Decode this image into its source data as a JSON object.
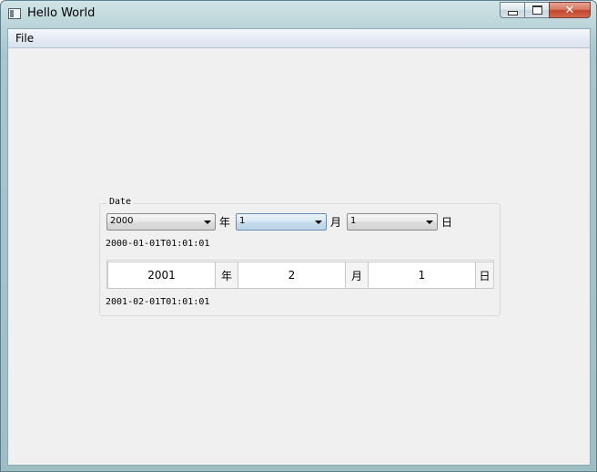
{
  "window": {
    "title": "Hello World",
    "close_glyph": "✕"
  },
  "menu": {
    "items": [
      "File"
    ]
  },
  "group": {
    "title": "Date",
    "combos": {
      "year": "2000",
      "month": "1",
      "day": "1"
    },
    "units": {
      "year": "年",
      "month": "月",
      "day": "日"
    },
    "datetime_1": "2000-01-01T01:01:01",
    "cells": {
      "year": "2001",
      "month": "2",
      "day": "1"
    },
    "datetime_2": "2001-02-01T01:01:01"
  },
  "icons": {
    "app": "window-app-icon",
    "minimize": "minimize-icon",
    "maximize": "maximize-icon",
    "close": "close-icon",
    "dropdown": "chevron-down-icon"
  }
}
